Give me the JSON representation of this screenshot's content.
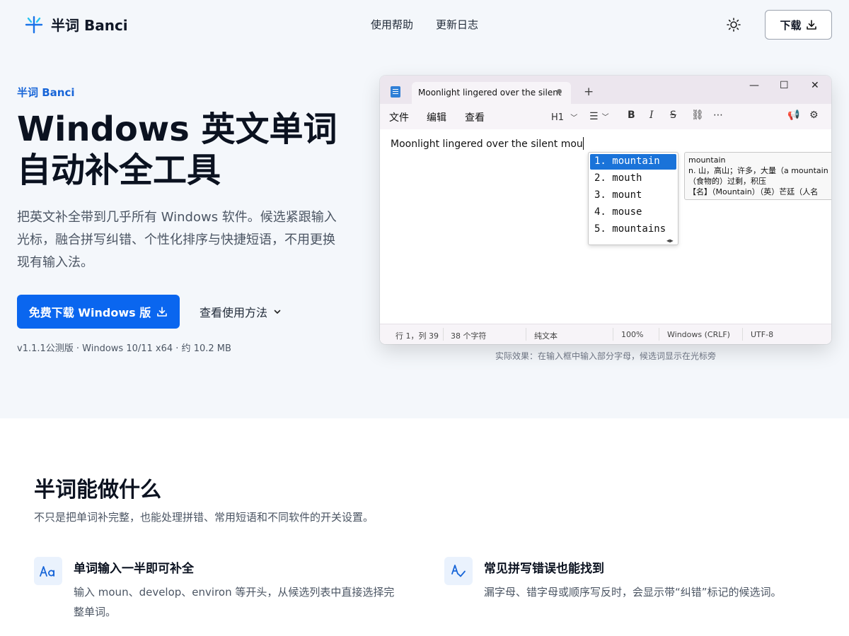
{
  "header": {
    "logo_text": "半词 Banci",
    "nav": [
      "使用帮助",
      "更新日志"
    ],
    "download_label": "下载"
  },
  "hero": {
    "eyebrow": "半词 Banci",
    "title_line1": "Windows 英文单词",
    "title_line2": "自动补全工具",
    "description": "把英文补全带到几乎所有 Windows 软件。候选紧跟输入光标，融合拼写纠错、个性化排序与快捷短语，不用更换现有输入法。",
    "primary_button": "免费下载 Windows 版",
    "howto_link": "查看使用方法",
    "version_info": "v1.1.1公测版 · Windows 10/11 x64 · 约 10.2 MB"
  },
  "editor": {
    "tab_title": "Moonlight lingered over the silent",
    "menus": [
      "文件",
      "编辑",
      "查看"
    ],
    "heading_select": "H1",
    "typed_text": "Moonlight lingered over the silent mou",
    "suggestions": [
      "1. mountain",
      "2. mouth",
      "3. mount",
      "4. mouse",
      "5. mountains"
    ],
    "selected_index": 0,
    "definition": {
      "word": "mountain",
      "line1": "n. 山，高山；许多，大量（a mountain",
      "line2": "（食物的）过剩，积压",
      "line3": "【名】（Mountain）（英）芒廷（人名"
    },
    "status": {
      "position": "行 1，列 39",
      "chars": "38 个字符",
      "format": "纯文本",
      "zoom": "100%",
      "line_ending": "Windows (CRLF)",
      "encoding": "UTF-8"
    }
  },
  "caption": "实际效果：在输入框中输入部分字母，候选词显示在光标旁",
  "features": {
    "title": "半词能做什么",
    "subtitle": "不只是把单词补完整，也能处理拼错、常用短语和不同软件的开关设置。",
    "items": [
      {
        "icon": "text-case-icon",
        "title": "单词输入一半即可补全",
        "desc_line1": "输入 moun、develop、environ 等开头，从候选列表中直接选择完",
        "desc_line2": "整单词。"
      },
      {
        "icon": "spell-check-icon",
        "title": "常见拼写错误也能找到",
        "desc_line1": "漏字母、错字母或顺序写反时，会显示带“纠错”标记的候选词。"
      }
    ]
  },
  "colors": {
    "accent": "#0a66ef",
    "hero_bg": "#f4f7fb",
    "eyebrow": "#1765d8",
    "suggestion_selected": "#1a73d9"
  }
}
